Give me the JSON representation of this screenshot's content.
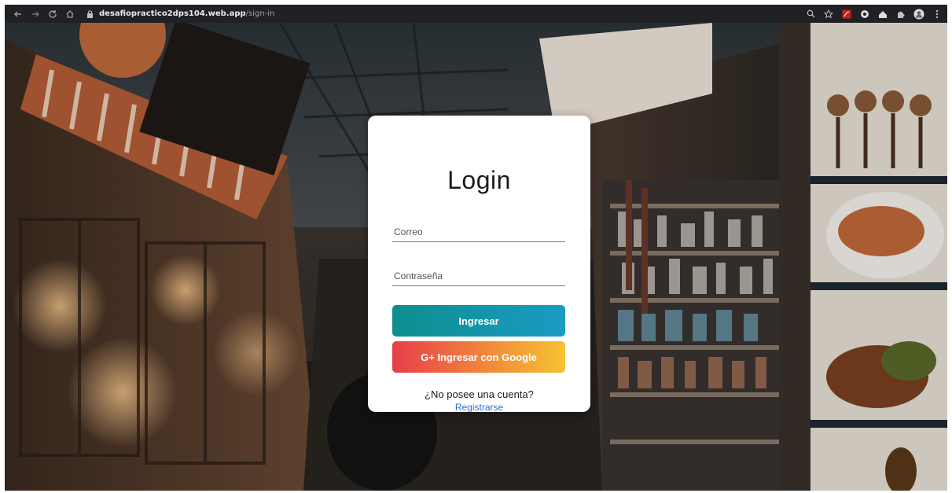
{
  "browser": {
    "url_host": "desafiopracticо2dps104.web.app",
    "url_path": "/sign-in",
    "nav_icons": [
      "back-icon",
      "forward-icon",
      "reload-icon",
      "home-icon"
    ],
    "ext_icons": [
      "zoom-icon",
      "star-icon",
      "pdf-extension-icon",
      "extension-icon",
      "extension-icon",
      "puzzle-icon",
      "profile-icon",
      "menu-icon"
    ]
  },
  "login": {
    "title": "Login",
    "email_placeholder": "Correo",
    "password_placeholder": "Contraseña",
    "submit_label": "Ingresar",
    "google_label": "G+ Ingresar con Google",
    "no_account_text": "¿No posee una cuenta?",
    "register_label": "Registrarse"
  },
  "colors": {
    "login_button": "#0e8e8e",
    "google_button": "#e63e4a",
    "link": "#2d6fd2"
  }
}
